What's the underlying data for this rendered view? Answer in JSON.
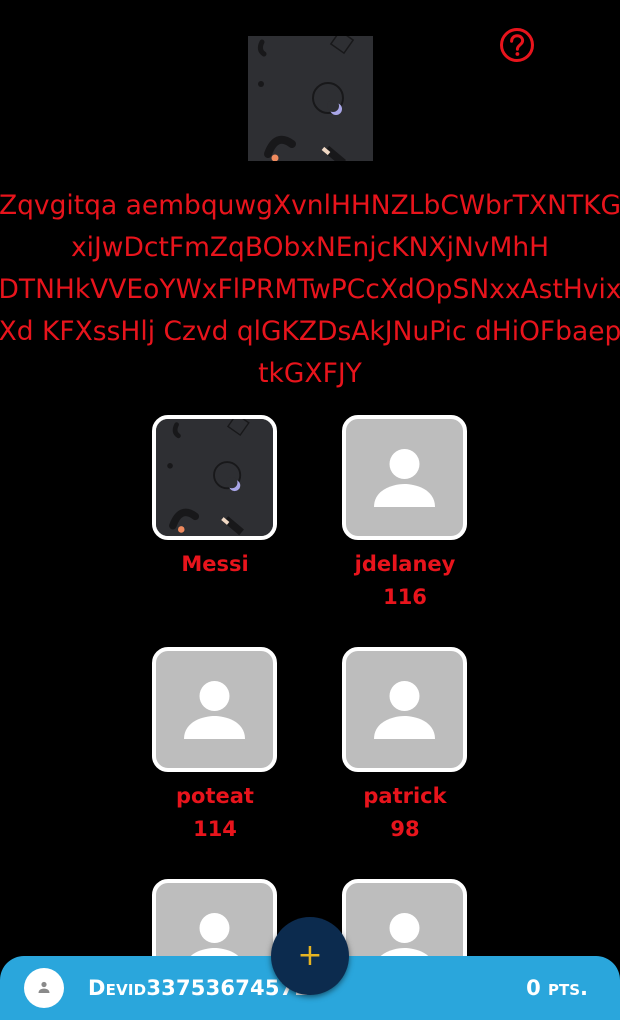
{
  "header": {
    "help_icon": "question-circle-icon",
    "image_icon": "abstract-pattern-image"
  },
  "description": {
    "lines": [
      "Zqvgitqa aembquwgXvnlHHNZLbCWbrTXNTKG",
      "xiJwDctFmZqBObxNEnjcKNXjNvMhH",
      "DTNHkVVEoYWxFlPRMTwPCcXdOpSNxxAstHvix",
      "Xd KFXssHlj Czvd qlGKZDsAkJNuPic dHiOFbaep",
      "tkGXFJY"
    ]
  },
  "players": [
    {
      "name": "Messi",
      "score": "",
      "avatar": "abstract-pattern-image"
    },
    {
      "name": "jdelaney",
      "score": "116",
      "avatar": "person-icon"
    },
    {
      "name": "poteat",
      "score": "114",
      "avatar": "person-icon"
    },
    {
      "name": "patrick",
      "score": "98",
      "avatar": "person-icon"
    },
    {
      "name": "",
      "score": "",
      "avatar": "person-icon"
    },
    {
      "name": "",
      "score": "",
      "avatar": "person-icon"
    }
  ],
  "fab": {
    "label": "+"
  },
  "bottom_bar": {
    "username": "Devid33753674572",
    "points": "0 pts.",
    "avatar_icon": "person-icon"
  },
  "colors": {
    "background": "#000000",
    "accent_red": "#e8141c",
    "bar_blue": "#2aa6dc",
    "fab_navy": "#0c2b4e",
    "fab_plus": "#e6b422",
    "placeholder_gray": "#bdbdbd"
  }
}
